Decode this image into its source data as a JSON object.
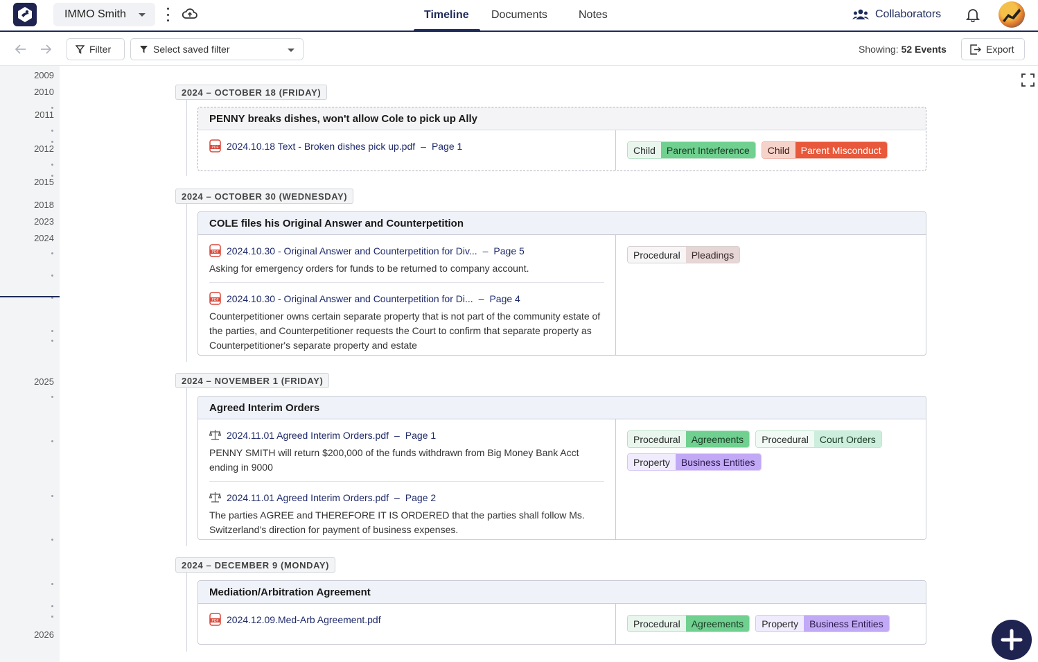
{
  "header": {
    "project_name": "IMMO Smith",
    "tabs": [
      {
        "label": "Timeline",
        "active": true
      },
      {
        "label": "Documents",
        "active": false
      },
      {
        "label": "Notes",
        "active": false
      }
    ],
    "collaborators_label": "Collaborators",
    "accent_color": "#1e2a5a"
  },
  "toolbar": {
    "filter_label": "Filter",
    "saved_filter_placeholder": "Select saved filter",
    "showing_label": "Showing:",
    "showing_value": "52 Events",
    "export_label": "Export"
  },
  "year_rail": {
    "years": [
      "2009",
      "2010",
      "2011",
      "2012",
      "2015",
      "2018",
      "2023",
      "2024",
      "2025",
      "2026"
    ]
  },
  "events": [
    {
      "date": "2024 – OCTOBER 18 (FRIDAY)",
      "title": "PENNY breaks dishes, won't allow Cole to pick up Ally",
      "sources": [
        {
          "icon": "pdf-icon",
          "file": "2024.10.18 Text - Broken dishes pick up.pdf",
          "page": "Page 1",
          "text": ""
        }
      ],
      "tags": [
        {
          "category": "Child",
          "label": "Parent Interference",
          "color": "green"
        },
        {
          "category": "Child",
          "label": "Parent Misconduct",
          "color": "red"
        }
      ]
    },
    {
      "date": "2024 – OCTOBER 30 (WEDNESDAY)",
      "title": "COLE files his Original Answer and Counterpetition",
      "sources": [
        {
          "icon": "pdf-icon",
          "file": "2024.10.30 - Original Answer and Counterpetition for Div...",
          "page": "Page 5",
          "text": "Asking for emergency orders for funds to be returned to company account."
        },
        {
          "icon": "pdf-icon",
          "file": "2024.10.30 - Original Answer and Counterpetition for Di...",
          "page": "Page 4",
          "text": "Counterpetitioner owns certain separate property that is not part of the community estate of the parties, and Counterpetitioner requests the Court to confirm that separate property as Counterpetitioner's separate property and estate"
        }
      ],
      "tags": [
        {
          "category": "Procedural",
          "label": "Pleadings",
          "color": "gray"
        }
      ]
    },
    {
      "date": "2024 – NOVEMBER 1 (FRIDAY)",
      "title": "Agreed Interim Orders",
      "sources": [
        {
          "icon": "scales-icon",
          "file": "2024.11.01 Agreed Interim Orders.pdf",
          "page": "Page 1",
          "text": "PENNY SMITH will return $200,000 of the funds withdrawn from Big Money Bank Acct ending in 9000"
        },
        {
          "icon": "scales-icon",
          "file": "2024.11.01 Agreed Interim Orders.pdf",
          "page": "Page 2",
          "text": "The parties AGREE and THEREFORE IT IS ORDERED that the parties shall follow Ms. Switzerland’s direction for payment of business expenses."
        }
      ],
      "tags": [
        {
          "category": "Procedural",
          "label": "Agreements",
          "color": "green"
        },
        {
          "category": "Procedural",
          "label": "Court Orders",
          "color": "green2"
        },
        {
          "category": "Property",
          "label": "Business Entities",
          "color": "purple"
        }
      ]
    },
    {
      "date": "2024 – DECEMBER 9 (MONDAY)",
      "title": "Mediation/Arbitration Agreement",
      "sources": [
        {
          "icon": "pdf-icon",
          "file": "2024.12.09.Med-Arb Agreement.pdf",
          "page": "",
          "text": ""
        }
      ],
      "tags": [
        {
          "category": "Procedural",
          "label": "Agreements",
          "color": "green"
        },
        {
          "category": "Property",
          "label": "Business Entities",
          "color": "purple"
        }
      ]
    }
  ]
}
